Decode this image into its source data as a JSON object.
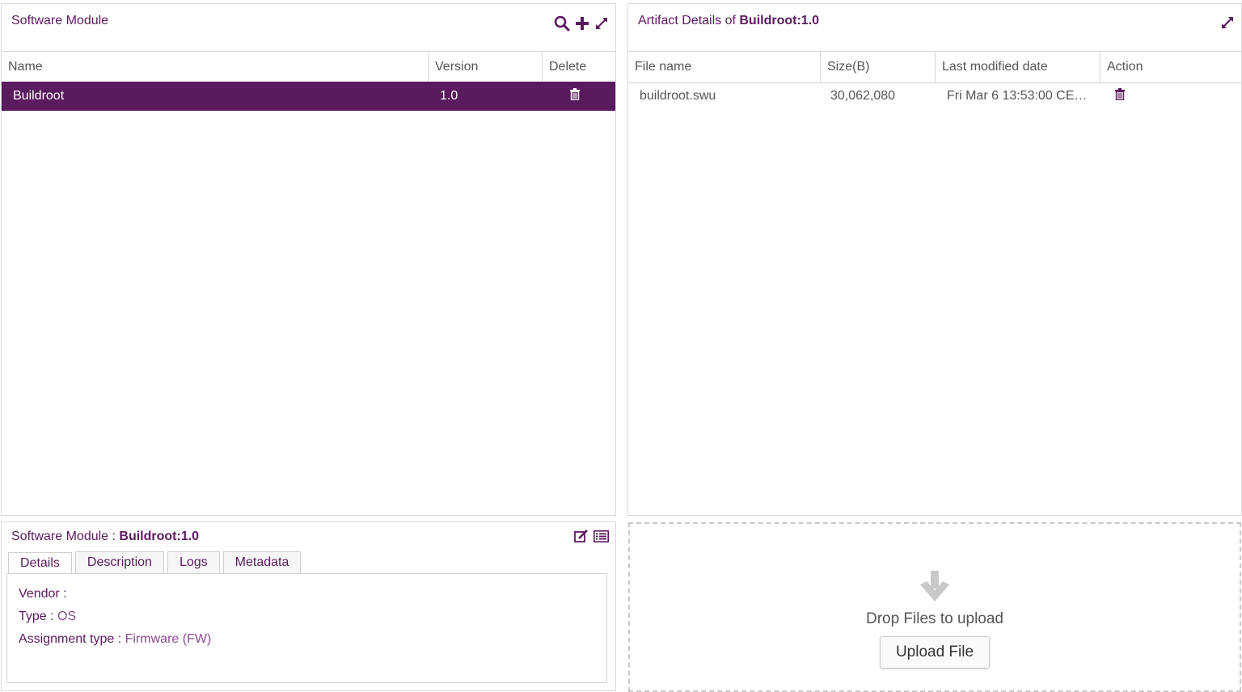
{
  "software_module": {
    "title": "Software Module",
    "columns": [
      "Name",
      "Version",
      "Delete"
    ],
    "rows": [
      {
        "name": "Buildroot",
        "version": "1.0"
      }
    ]
  },
  "artifact_details": {
    "title_prefix": "Artifact Details of ",
    "title_value": "Buildroot:1.0",
    "columns": [
      "File name",
      "Size(B)",
      "Last modified date",
      "Action"
    ],
    "rows": [
      {
        "file_name": "buildroot.swu",
        "size": "30,062,080",
        "modified": "Fri Mar 6 13:53:00 CET..."
      }
    ]
  },
  "details_panel": {
    "title_prefix": "Software Module : ",
    "title_value": "Buildroot:1.0",
    "tabs": [
      "Details",
      "Description",
      "Logs",
      "Metadata"
    ],
    "fields": {
      "vendor_label": "Vendor :",
      "vendor_value": "",
      "type_label": "Type :",
      "type_value": "OS",
      "assignment_label": "Assignment type :",
      "assignment_value": "Firmware (FW)"
    }
  },
  "upload": {
    "drop_text": "Drop Files to upload",
    "button_label": "Upload File"
  },
  "colors": {
    "accent": "#5a1a5e",
    "border": "#d9d9d9"
  }
}
